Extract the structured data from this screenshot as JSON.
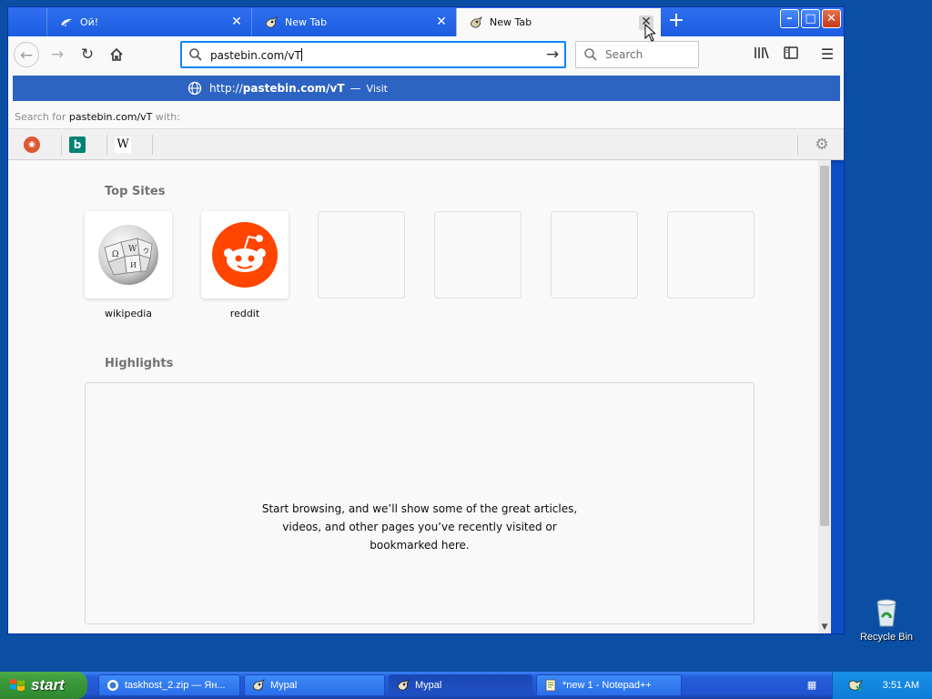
{
  "desktop": {
    "recycle_bin_label": "Recycle Bin"
  },
  "browser": {
    "tabs": [
      {
        "title": "Ой!",
        "active": false
      },
      {
        "title": "New Tab",
        "active": false
      },
      {
        "title": "New Tab",
        "active": true
      }
    ],
    "new_tab_symbol": "+",
    "window_controls": {
      "minimize": "–",
      "maximize": "□",
      "close": "✕"
    },
    "urlbar": {
      "value": "pastebin.com/vT"
    },
    "searchbar": {
      "placeholder": "Search"
    },
    "popup": {
      "suggestion_prefix": "http://",
      "suggestion_bold": "pastebin.com/vT",
      "suggestion_dash": "—",
      "suggestion_action": "Visit",
      "search_with_prefix": "Search for ",
      "search_with_query": "pastebin.com/vT",
      "search_with_suffix": " with:",
      "engines": [
        "DuckDuckGo",
        "Bing",
        "Wikipedia"
      ]
    },
    "newtab": {
      "top_sites_title": "Top Sites",
      "top_sites": [
        {
          "label": "wikipedia"
        },
        {
          "label": "reddit"
        }
      ],
      "highlights_title": "Highlights",
      "highlights_empty": "Start browsing, and we’ll show some of the great articles, videos, and other pages you’ve recently visited or bookmarked here."
    }
  },
  "taskbar": {
    "start_label": "start",
    "tasks": [
      {
        "label": "taskhost_2.zip — Ян...",
        "icon": "yandex-icon",
        "active": false
      },
      {
        "label": "Mypal",
        "icon": "mypal-icon",
        "active": false
      },
      {
        "label": "Mypal",
        "icon": "mypal-icon",
        "active": true
      },
      {
        "label": "*new 1 - Notepad++",
        "icon": "notepad-icon",
        "active": false
      }
    ],
    "clock": "3:51 AM"
  },
  "colors": {
    "desktop": "#0a4fa3",
    "accent": "#0a84ff",
    "suggestion_bg": "#2d63c3",
    "reddit": "#ff4500",
    "start_green": "#3a963a"
  }
}
